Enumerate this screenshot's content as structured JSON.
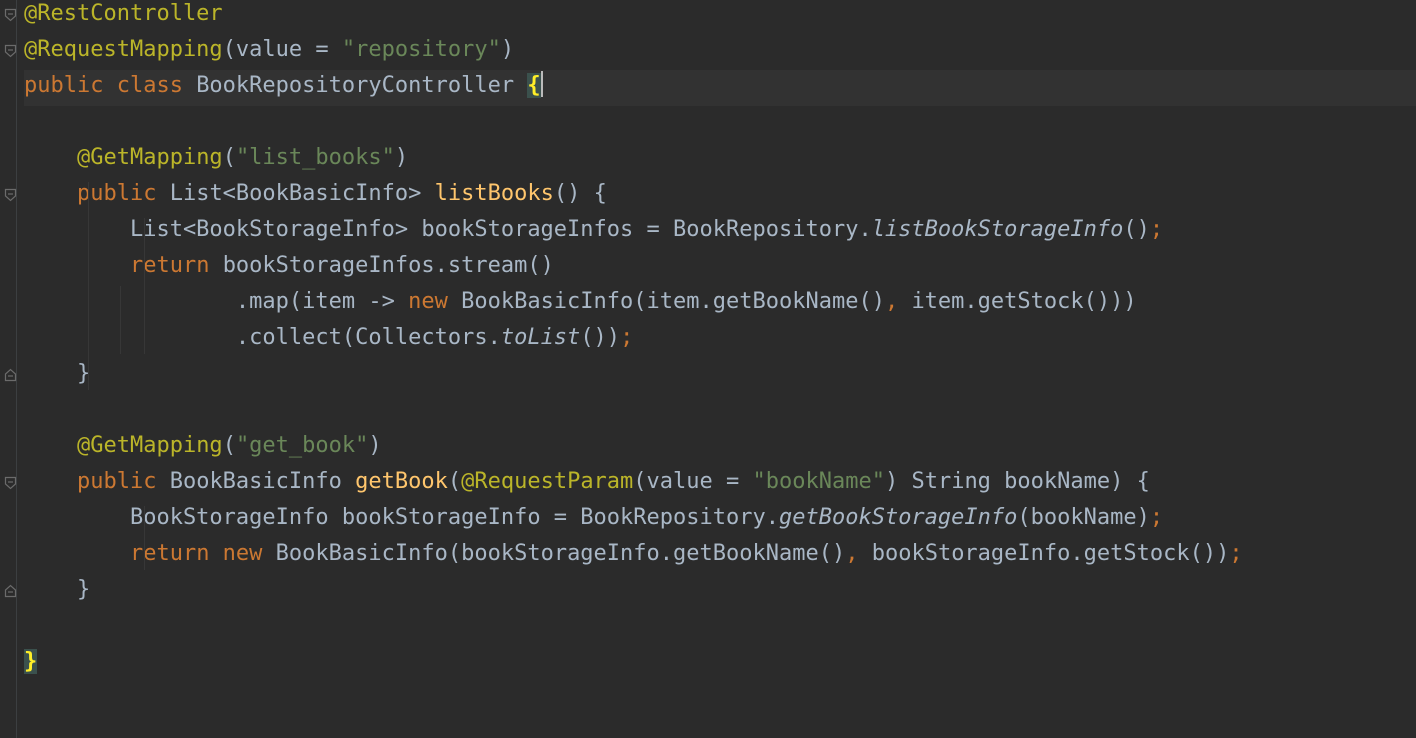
{
  "lines": [
    {
      "t": [
        {
          "c": "ann",
          "v": "@RestController"
        }
      ]
    },
    {
      "t": [
        {
          "c": "ann",
          "v": "@RequestMapping"
        },
        {
          "c": "p",
          "v": "(value = "
        },
        {
          "c": "str",
          "v": "\"repository\""
        },
        {
          "c": "p",
          "v": ")"
        }
      ]
    },
    {
      "t": [
        {
          "c": "kw",
          "v": "public class "
        },
        {
          "c": "p",
          "v": "BookRepositoryController "
        },
        {
          "c": "brace-hl",
          "v": "{"
        }
      ]
    },
    {
      "t": []
    },
    {
      "t": [
        {
          "c": "p",
          "v": "    "
        },
        {
          "c": "ann",
          "v": "@GetMapping"
        },
        {
          "c": "p",
          "v": "("
        },
        {
          "c": "str",
          "v": "\"list_books\""
        },
        {
          "c": "p",
          "v": ")"
        }
      ]
    },
    {
      "t": [
        {
          "c": "p",
          "v": "    "
        },
        {
          "c": "kw",
          "v": "public "
        },
        {
          "c": "p",
          "v": "List<BookBasicInfo> "
        },
        {
          "c": "fn",
          "v": "listBooks"
        },
        {
          "c": "p",
          "v": "() {"
        }
      ]
    },
    {
      "t": [
        {
          "c": "p",
          "v": "        List<BookStorageInfo> bookStorageInfos = BookRepository."
        },
        {
          "c": "ital",
          "v": "listBookStorageInfo"
        },
        {
          "c": "p",
          "v": "()"
        },
        {
          "c": "semi",
          "v": ";"
        }
      ]
    },
    {
      "t": [
        {
          "c": "p",
          "v": "        "
        },
        {
          "c": "kw",
          "v": "return "
        },
        {
          "c": "p",
          "v": "bookStorageInfos.stream()"
        }
      ]
    },
    {
      "t": [
        {
          "c": "p",
          "v": "                .map(item -> "
        },
        {
          "c": "kw",
          "v": "new "
        },
        {
          "c": "p",
          "v": "BookBasicInfo(item.getBookName()"
        },
        {
          "c": "kw",
          "v": ", "
        },
        {
          "c": "p",
          "v": "item.getStock()))"
        }
      ]
    },
    {
      "t": [
        {
          "c": "p",
          "v": "                .collect(Collectors."
        },
        {
          "c": "ital",
          "v": "toList"
        },
        {
          "c": "p",
          "v": "())"
        },
        {
          "c": "semi",
          "v": ";"
        }
      ]
    },
    {
      "t": [
        {
          "c": "p",
          "v": "    }"
        }
      ]
    },
    {
      "t": []
    },
    {
      "t": [
        {
          "c": "p",
          "v": "    "
        },
        {
          "c": "ann",
          "v": "@GetMapping"
        },
        {
          "c": "p",
          "v": "("
        },
        {
          "c": "str",
          "v": "\"get_book\""
        },
        {
          "c": "p",
          "v": ")"
        }
      ]
    },
    {
      "t": [
        {
          "c": "p",
          "v": "    "
        },
        {
          "c": "kw",
          "v": "public "
        },
        {
          "c": "p",
          "v": "BookBasicInfo "
        },
        {
          "c": "fn",
          "v": "getBook"
        },
        {
          "c": "p",
          "v": "("
        },
        {
          "c": "ann",
          "v": "@RequestParam"
        },
        {
          "c": "p",
          "v": "(value = "
        },
        {
          "c": "str",
          "v": "\"bookName\""
        },
        {
          "c": "p",
          "v": ") String bookName) {"
        }
      ]
    },
    {
      "t": [
        {
          "c": "p",
          "v": "        BookStorageInfo bookStorageInfo = BookRepository."
        },
        {
          "c": "ital",
          "v": "getBookStorageInfo"
        },
        {
          "c": "p",
          "v": "(bookName)"
        },
        {
          "c": "semi",
          "v": ";"
        }
      ]
    },
    {
      "t": [
        {
          "c": "p",
          "v": "        "
        },
        {
          "c": "kw",
          "v": "return new "
        },
        {
          "c": "p",
          "v": "BookBasicInfo(bookStorageInfo.getBookName()"
        },
        {
          "c": "kw",
          "v": ", "
        },
        {
          "c": "p",
          "v": "bookStorageInfo.getStock())"
        },
        {
          "c": "semi",
          "v": ";"
        }
      ]
    },
    {
      "t": [
        {
          "c": "p",
          "v": "    }"
        }
      ]
    },
    {
      "t": []
    },
    {
      "t": [
        {
          "c": "brace-hl",
          "v": "}"
        }
      ]
    }
  ],
  "fold_markers": [
    {
      "line": 0,
      "kind": "open"
    },
    {
      "line": 1,
      "kind": "open"
    },
    {
      "line": 5,
      "kind": "open"
    },
    {
      "line": 10,
      "kind": "close"
    },
    {
      "line": 13,
      "kind": "open"
    },
    {
      "line": 16,
      "kind": "close"
    }
  ],
  "current_line": 2,
  "colors": {
    "background": "#2b2b2b",
    "text": "#a9b7c6",
    "annotation": "#bbb529",
    "keyword": "#cc7832",
    "string": "#6a8759",
    "method": "#ffc66d"
  }
}
